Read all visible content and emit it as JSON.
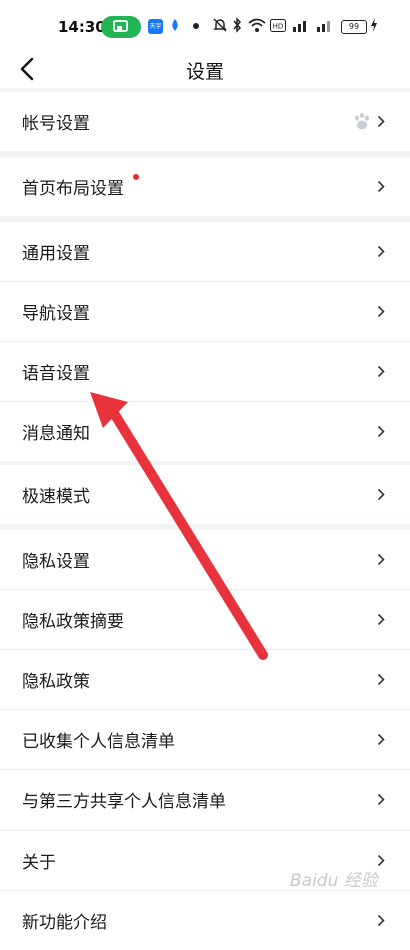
{
  "status_bar": {
    "time": "14:30",
    "app_badge": "天宇",
    "battery": "99"
  },
  "header": {
    "title": "设置"
  },
  "groups": [
    {
      "items": [
        {
          "label": "帐号设置"
        }
      ]
    },
    {
      "items": [
        {
          "label": "首页布局设置"
        }
      ]
    },
    {
      "items": [
        {
          "label": "通用设置"
        },
        {
          "label": "导航设置"
        },
        {
          "label": "语音设置"
        },
        {
          "label": "消息通知"
        }
      ]
    },
    {
      "items": [
        {
          "label": "极速模式"
        }
      ]
    },
    {
      "items": [
        {
          "label": "隐私设置"
        },
        {
          "label": "隐私政策摘要"
        },
        {
          "label": "隐私政策"
        },
        {
          "label": "已收集个人信息清单"
        },
        {
          "label": "与第三方共享个人信息清单"
        }
      ]
    },
    {
      "items": [
        {
          "label": "关于"
        },
        {
          "label": "新功能介绍"
        }
      ]
    }
  ],
  "watermark": "Baidu 经验",
  "colors": {
    "accent_green": "#22b455",
    "arrow_red": "#e8333c",
    "notification_dot": "#e62e2e"
  }
}
